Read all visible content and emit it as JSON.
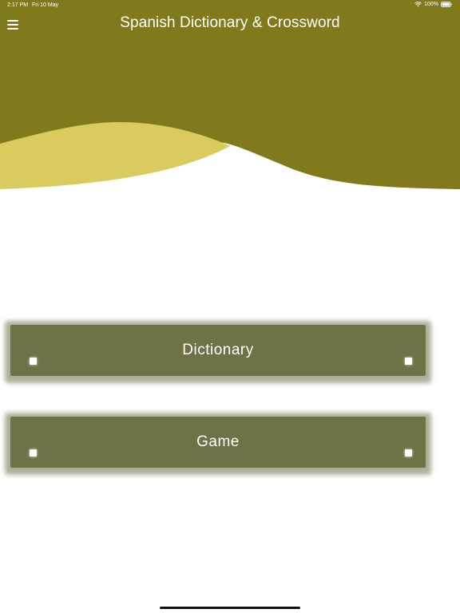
{
  "status_bar": {
    "time": "2:17 PM",
    "date": "Fri 10 May",
    "battery": "100%"
  },
  "header": {
    "title": "Spanish Dictionary & Crossword"
  },
  "buttons": {
    "dictionary_label": "Dictionary",
    "game_label": "Game"
  },
  "colors": {
    "header_olive": "#817a1d",
    "wave_yellow": "#d9cb5d",
    "button_olive": "#6f7146"
  },
  "icons": {
    "menu": "hamburger-menu-icon",
    "wifi": "wifi-icon",
    "battery": "battery-icon"
  }
}
